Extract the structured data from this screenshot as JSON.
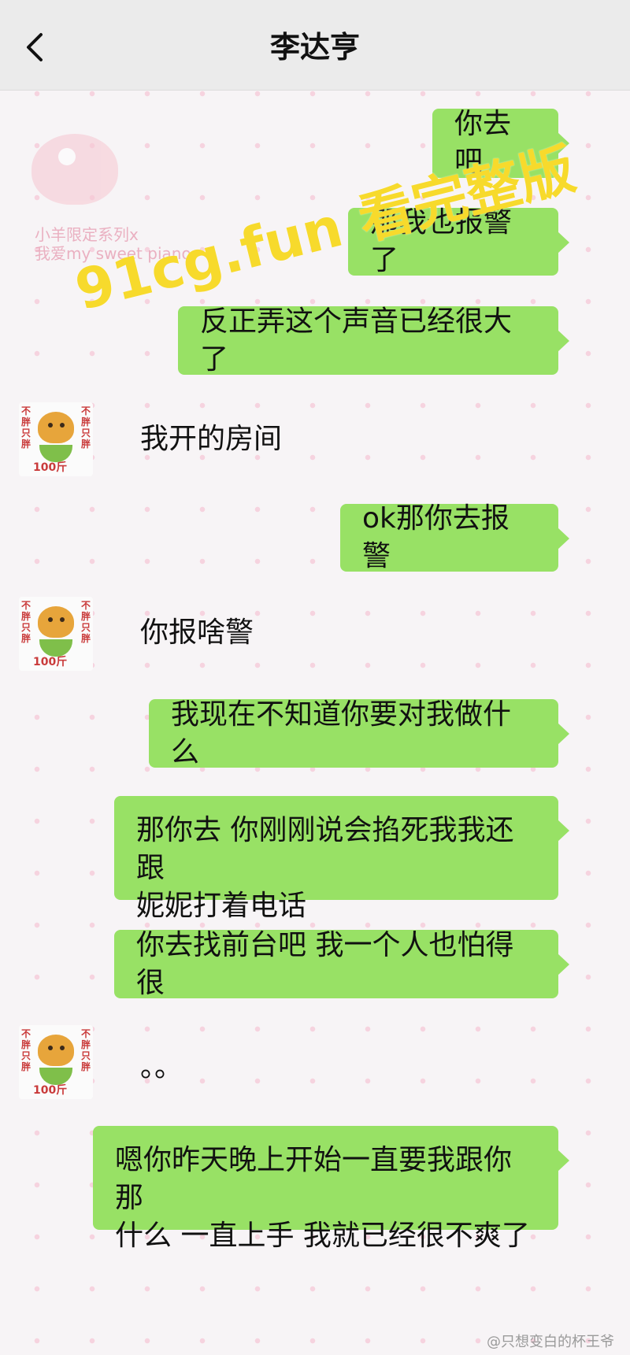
{
  "header": {
    "title": "李达亨"
  },
  "watermark": "91cg.fun 看完整版",
  "background": {
    "sticker_text_line1": "小羊限定系列x",
    "sticker_text_line2": "我爱my sweet piano"
  },
  "avatar": {
    "left_text": "不胖只胖",
    "right_text": "不胖只胖",
    "number": "100斤"
  },
  "messages": [
    {
      "side": "out",
      "lines": [
        "你去吧"
      ]
    },
    {
      "side": "out",
      "lines": [
        "那我也报警了"
      ]
    },
    {
      "side": "out",
      "lines": [
        "反正弄这个声音已经很大了"
      ]
    },
    {
      "side": "in",
      "lines": [
        "我开的房间"
      ]
    },
    {
      "side": "out",
      "lines": [
        "ok那你去报警"
      ]
    },
    {
      "side": "in",
      "lines": [
        "你报啥警"
      ]
    },
    {
      "side": "out",
      "lines": [
        "我现在不知道你要对我做什么"
      ]
    },
    {
      "side": "out",
      "lines": [
        "那你去 你刚刚说会掐死我我还跟",
        "妮妮打着电话"
      ]
    },
    {
      "side": "out",
      "lines": [
        "你去找前台吧 我一个人也怕得很"
      ]
    },
    {
      "side": "in",
      "lines": [
        "。。"
      ]
    },
    {
      "side": "out",
      "lines": [
        "嗯你昨天晚上开始一直要我跟你那",
        "什么 一直上手 我就已经很不爽了"
      ]
    }
  ],
  "footer_watermark": "@只想变白的杯王爷",
  "colors": {
    "bubble_out": "#98e165",
    "header_bg": "#ebebeb",
    "watermark": "#f7da2c"
  },
  "icons": {
    "back": "chevron-left-icon"
  }
}
